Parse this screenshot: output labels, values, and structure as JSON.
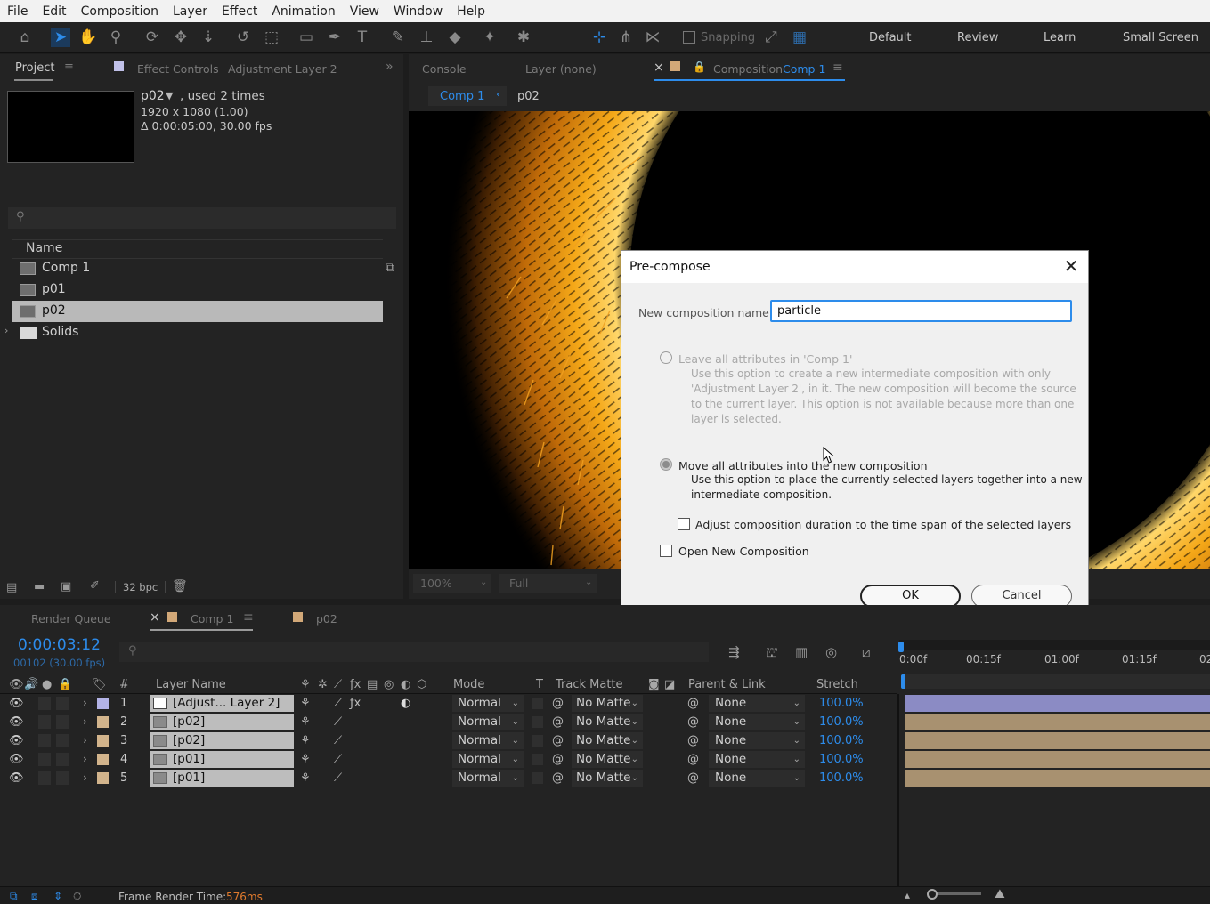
{
  "menu": [
    "File",
    "Edit",
    "Composition",
    "Layer",
    "Effect",
    "Animation",
    "View",
    "Window",
    "Help"
  ],
  "toolbar": {
    "snapping_label": "Snapping"
  },
  "workspaces": [
    "Default",
    "Review",
    "Learn",
    "Small Screen"
  ],
  "project_panel": {
    "tab_project": "Project",
    "tab_effect_controls": "Effect Controls",
    "tab_effect_controls_target": "Adjustment Layer 2",
    "selected_item": {
      "name": "p02",
      "usage": ", used 2 times",
      "resolution": "1920 x 1080 (1.00)",
      "duration": "Δ 0:00:05:00, 30.00 fps"
    },
    "column_name": "Name",
    "items": [
      {
        "label": "Comp 1",
        "type": "comp"
      },
      {
        "label": "p01",
        "type": "comp"
      },
      {
        "label": "p02",
        "type": "comp",
        "selected": true
      },
      {
        "label": "Solids",
        "type": "folder"
      }
    ],
    "bpc": "32 bpc"
  },
  "comp_panel": {
    "tab_console": "Console",
    "tab_layer": "Layer (none)",
    "tab_composition_prefix": "Composition",
    "tab_composition_name": "Comp 1",
    "breadcrumb": [
      "Comp 1",
      "p02"
    ],
    "zoom": "100%",
    "resolution": "Full"
  },
  "dialog": {
    "title": "Pre-compose",
    "name_label": "New composition name:",
    "name_value": "particle",
    "option1_label": "Leave all attributes in 'Comp 1'",
    "option1_desc": [
      "Use this option to create a new intermediate composition with only",
      "'Adjustment Layer 2', in it. The new composition will become the source",
      "to the current layer. This option is not available because more than one",
      "layer is selected."
    ],
    "option2_label": "Move all attributes into the new composition",
    "option2_desc": [
      "Use this option to place the currently selected layers together into a new",
      "intermediate composition."
    ],
    "adjust_duration_label": "Adjust composition duration to the time span of the selected layers",
    "open_new_label": "Open New Composition",
    "ok_label": "OK",
    "cancel_label": "Cancel"
  },
  "timeline": {
    "tab_render_queue": "Render Queue",
    "tab_comp1": "Comp 1",
    "tab_p02": "p02",
    "current_time": "0:00:03:12",
    "frame_info": "00102 (30.00 fps)",
    "ruler": [
      "0:00f",
      "00:15f",
      "01:00f",
      "01:15f",
      "02"
    ],
    "headers": {
      "num": "#",
      "layer_name": "Layer Name",
      "mode": "Mode",
      "t": "T",
      "track_matte": "Track Matte",
      "parent": "Parent & Link",
      "stretch": "Stretch"
    },
    "layers": [
      {
        "num": "1",
        "name": "[Adjust... Layer 2]",
        "label_color": "#b3b3e6",
        "mode": "Normal",
        "matte": "No Matte",
        "parent": "None",
        "stretch": "100.0%",
        "bar_color": "#8b8bc4"
      },
      {
        "num": "2",
        "name": "[p02]",
        "label_color": "#d2b48c",
        "mode": "Normal",
        "matte": "No Matte",
        "parent": "None",
        "stretch": "100.0%",
        "bar_color": "#a89170"
      },
      {
        "num": "3",
        "name": "[p02]",
        "label_color": "#d2b48c",
        "mode": "Normal",
        "matte": "No Matte",
        "parent": "None",
        "stretch": "100.0%",
        "bar_color": "#a89170"
      },
      {
        "num": "4",
        "name": "[p01]",
        "label_color": "#d2b48c",
        "mode": "Normal",
        "matte": "No Matte",
        "parent": "None",
        "stretch": "100.0%",
        "bar_color": "#a89170"
      },
      {
        "num": "5",
        "name": "[p01]",
        "label_color": "#d2b48c",
        "mode": "Normal",
        "matte": "No Matte",
        "parent": "None",
        "stretch": "100.0%",
        "bar_color": "#a89170"
      }
    ],
    "render_time_label": "Frame Render Time:",
    "render_time_value": "576ms"
  }
}
